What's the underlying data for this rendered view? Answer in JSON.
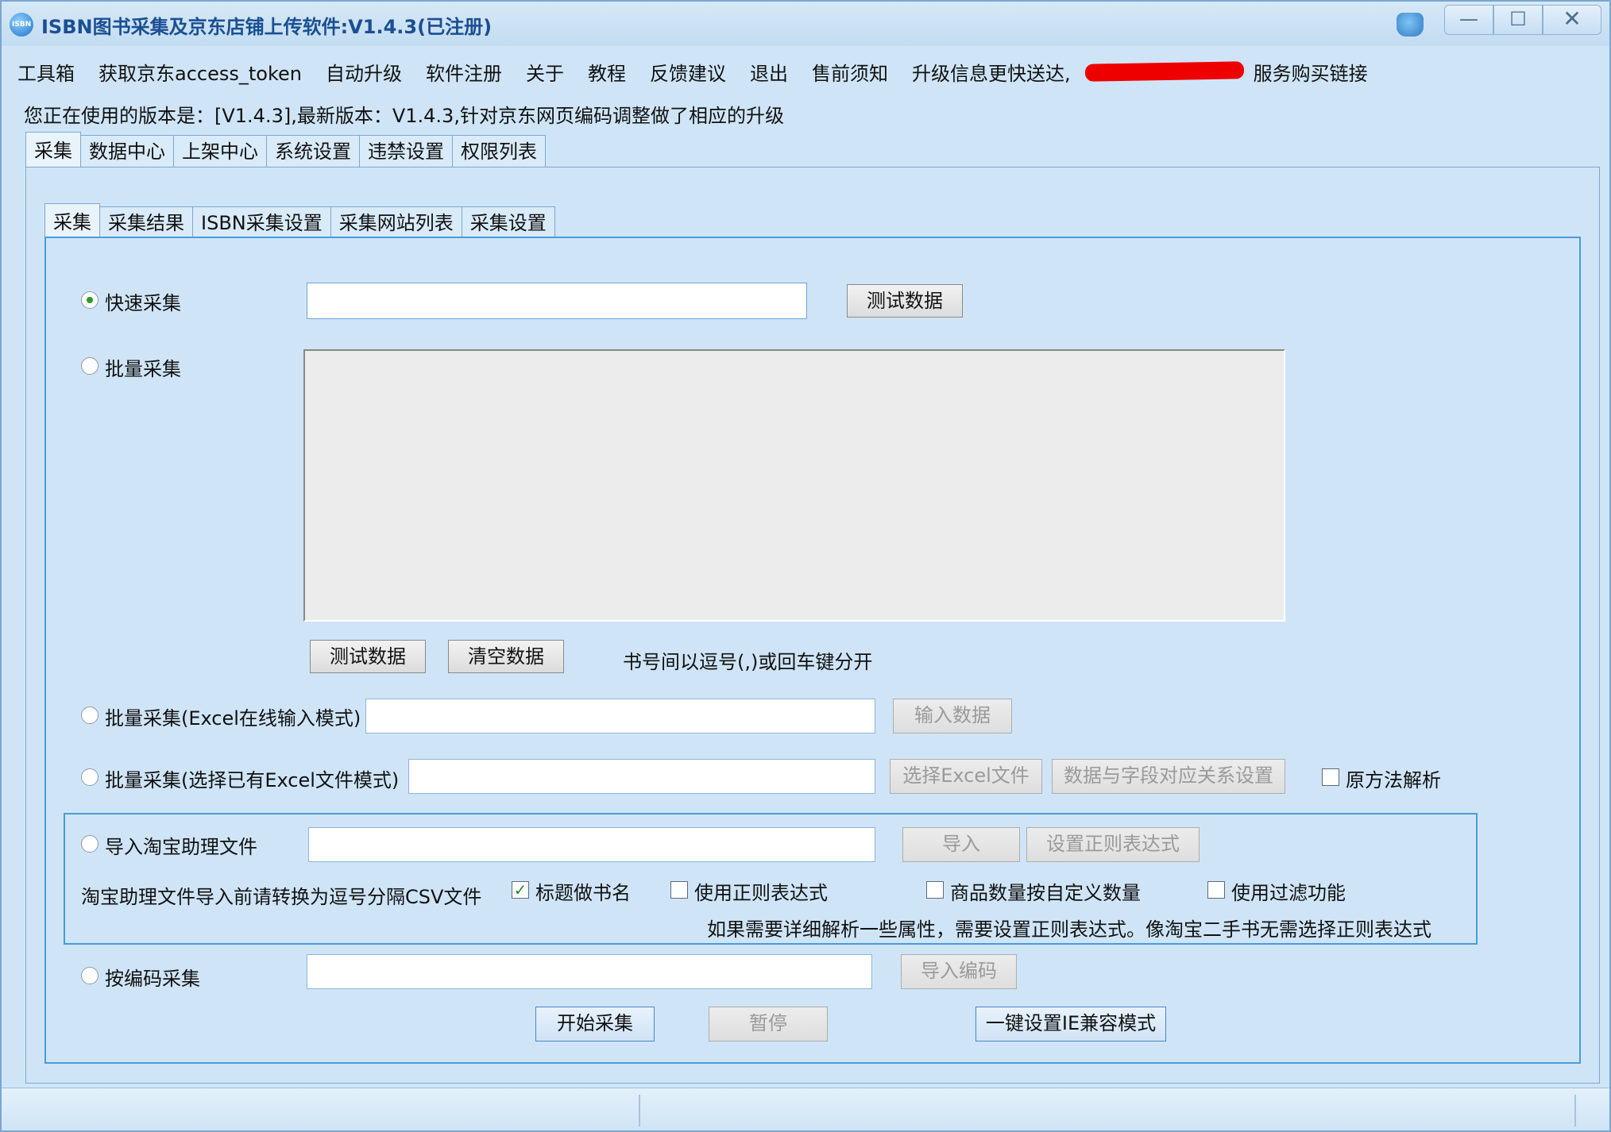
{
  "window": {
    "title": "ISBN图书采集及京东店铺上传软件:V1.4.3(已注册)",
    "app_icon_text": "ISBN",
    "min_glyph": "—",
    "max_glyph": "☐",
    "close_glyph": "✕"
  },
  "menu": {
    "items": [
      "工具箱",
      "获取京东access_token",
      "自动升级",
      "软件注册",
      "关于",
      "教程",
      "反馈建议",
      "退出",
      "售前须知",
      "升级信息更快送达,"
    ],
    "trailing": "服务购买链接"
  },
  "version_line": "您正在使用的版本是：[V1.4.3],最新版本：V1.4.3,针对京东网页编码调整做了相应的升级",
  "outer_tabs": [
    "采集",
    "数据中心",
    "上架中心",
    "系统设置",
    "违禁设置",
    "权限列表"
  ],
  "inner_tabs": [
    "采集",
    "采集结果",
    "ISBN采集设置",
    "采集网站列表",
    "采集设置"
  ],
  "quick_collect": {
    "label": "快速采集",
    "selected": true,
    "input_value": "",
    "test_button": "测试数据"
  },
  "batch_collect": {
    "label": "批量采集",
    "selected": false,
    "textarea_value": "",
    "test_button": "测试数据",
    "clear_button": "清空数据",
    "hint": "书号间以逗号(,)或回车键分开"
  },
  "excel_online": {
    "label": "批量采集(Excel在线输入模式)",
    "input_value": "",
    "input_button": "输入数据"
  },
  "excel_file": {
    "label": "批量采集(选择已有Excel文件模式)",
    "input_value": "",
    "select_button": "选择Excel文件",
    "mapping_button": "数据与字段对应关系设置",
    "raw_parse_label": "原方法解析",
    "raw_parse_checked": false
  },
  "taobao": {
    "label": "导入淘宝助理文件",
    "input_value": "",
    "import_button": "导入",
    "regex_button": "设置正则表达式",
    "note": "淘宝助理文件导入前请转换为逗号分隔CSV文件",
    "title_as_name_label": "标题做书名",
    "title_as_name_checked": true,
    "use_regex_label": "使用正则表达式",
    "use_regex_checked": false,
    "custom_qty_label": "商品数量按自定义数量",
    "custom_qty_checked": false,
    "filter_label": "使用过滤功能",
    "filter_checked": false,
    "regex_hint": "如果需要详细解析一些属性，需要设置正则表达式。像淘宝二手书无需选择正则表达式"
  },
  "code_collect": {
    "label": "按编码采集",
    "input_value": "",
    "import_button": "导入编码"
  },
  "actions": {
    "start": "开始采集",
    "pause": "暂停",
    "ie_compat": "一键设置IE兼容模式"
  },
  "check_glyph": "✓"
}
